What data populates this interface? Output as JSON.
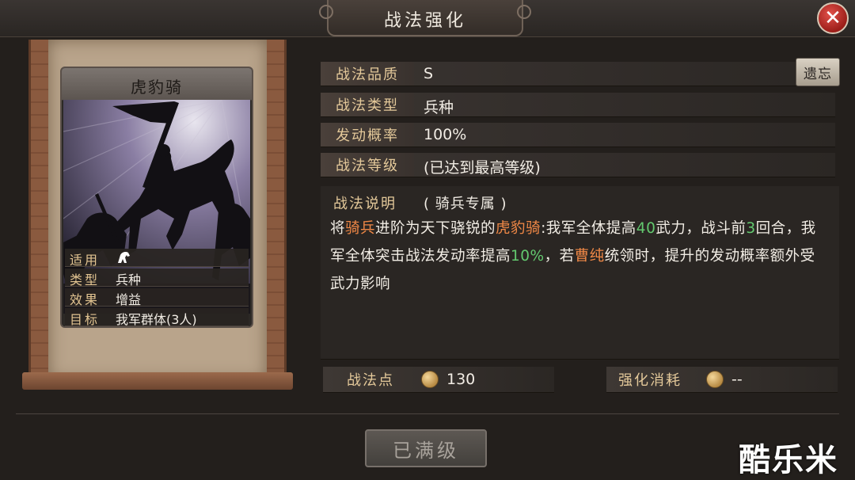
{
  "header": {
    "title": "战法强化",
    "close_icon": "close-icon"
  },
  "card": {
    "name": "虎豹骑",
    "props": [
      {
        "label": "适用",
        "value": "",
        "icon": "cavalry-horse-icon"
      },
      {
        "label": "类型",
        "value": "兵种"
      },
      {
        "label": "效果",
        "value": "增益"
      },
      {
        "label": "目标",
        "value": "我军群体(3人)"
      }
    ]
  },
  "info": {
    "quality_label": "战法品质",
    "quality_value": "S",
    "type_label": "战法类型",
    "type_value": "兵种",
    "rate_label": "发动概率",
    "rate_value": "100%",
    "level_label": "战法等级",
    "level_value": "(已达到最高等级)",
    "remove_button": "遗忘"
  },
  "description": {
    "label": "战法说明",
    "note": "( 骑兵专属 )",
    "segments": [
      {
        "text": "将",
        "style": "normal"
      },
      {
        "text": "骑兵",
        "style": "orange"
      },
      {
        "text": "进阶为天下骁锐的",
        "style": "normal"
      },
      {
        "text": "虎豹骑",
        "style": "orange"
      },
      {
        "text": ":我军全体提高",
        "style": "normal"
      },
      {
        "text": "40",
        "style": "green"
      },
      {
        "text": "武力，战斗前",
        "style": "normal"
      },
      {
        "text": "3",
        "style": "green"
      },
      {
        "text": "回合，我军全体突击战法发动率提高",
        "style": "normal"
      },
      {
        "text": "10%",
        "style": "green"
      },
      {
        "text": "，若",
        "style": "normal"
      },
      {
        "text": "曹纯",
        "style": "orange"
      },
      {
        "text": "统领时，提升的发动概率额外受武力影响",
        "style": "normal"
      }
    ]
  },
  "points": {
    "label": "战法点",
    "value": "130",
    "cost_label": "强化消耗",
    "cost_value": "--"
  },
  "footer": {
    "button": "已满级"
  },
  "watermark": "酷乐米",
  "colors": {
    "highlight_orange": "#f08846",
    "highlight_green": "#63c96f",
    "label_gold": "#e4c99a"
  }
}
